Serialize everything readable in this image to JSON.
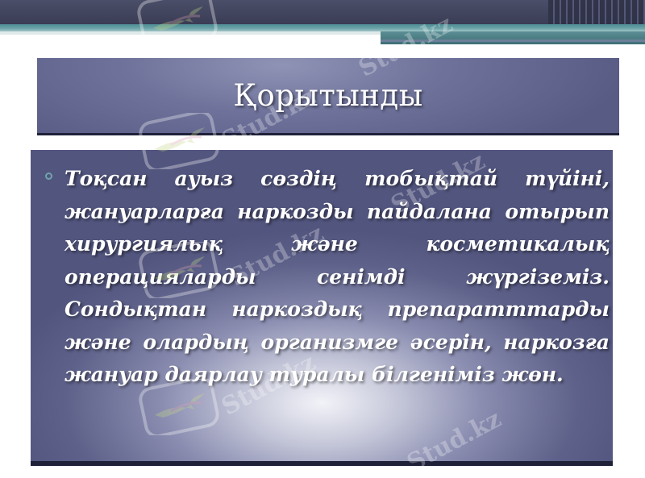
{
  "slide": {
    "title": "Қорытынды",
    "bullet_text": "Тоқсан ауыз сөздің тобықтай түйіні, жануарларға наркозды пайдалана отырып хирургиялық және косметикалық операцияларды сенімді жүргіземіз. Сондықтан наркоздық препаратттарды және олардың организмге әсерін, наркозға жануар даярлау туралы білгеніміз жөн."
  },
  "watermark": {
    "text": "Stud.kz"
  },
  "colors": {
    "top_bar": "#3a3d55",
    "accent_stripe": "#6aa3a8",
    "title_box": "#6f739b",
    "content_box": "#5e6189",
    "text": "#ffffff"
  }
}
